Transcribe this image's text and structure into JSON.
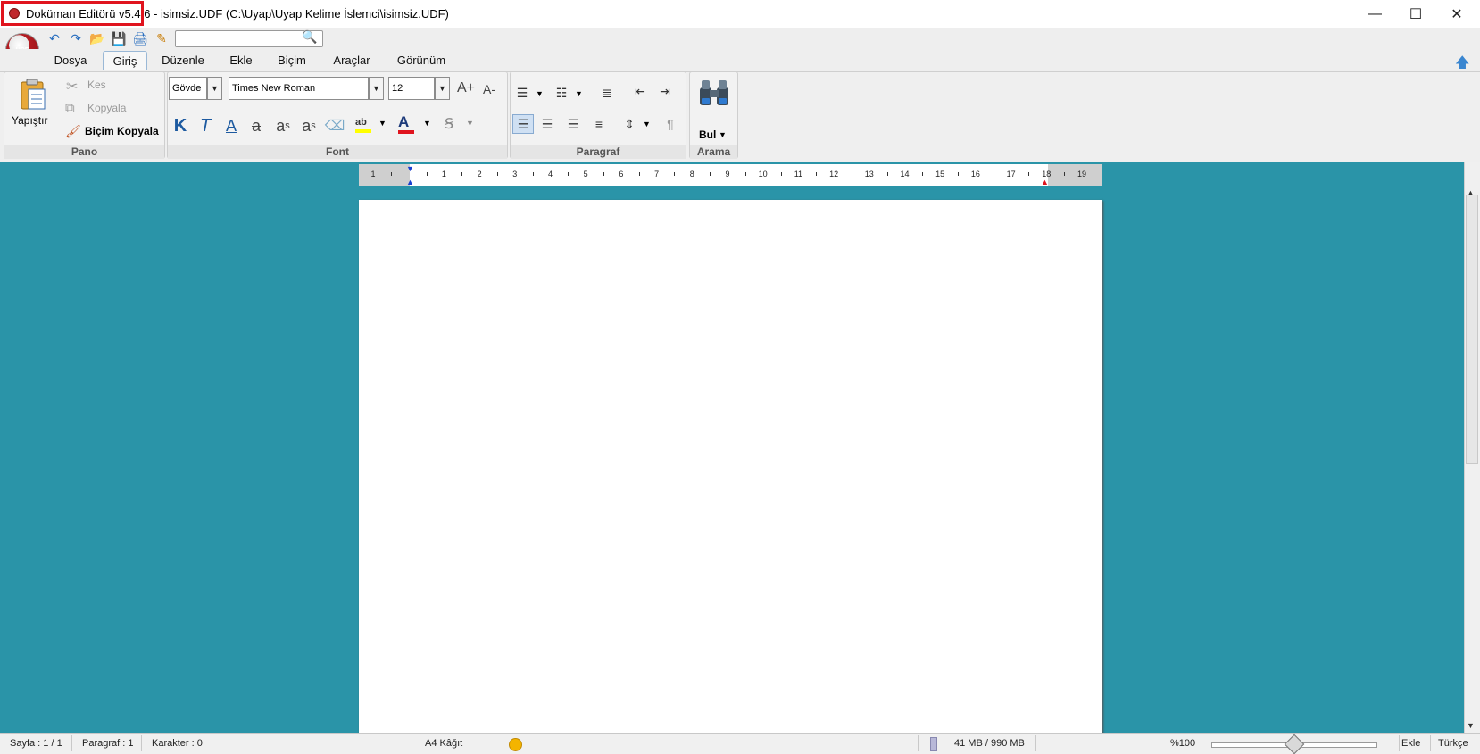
{
  "window": {
    "title_app": "Doküman Editörü v5.4.6",
    "title_file": " - isimsiz.UDF (C:\\Uyap\\Uyap Kelime İslemci\\isimsiz.UDF)",
    "minimize": "—",
    "maximize": "☐",
    "close": "✕"
  },
  "quick_toolbar": {
    "logo_text": "UDF",
    "undo_icon": "↶",
    "redo_icon": "↷",
    "open_icon": "📂",
    "save_icon": "💾",
    "print_icon": "🖨",
    "edit_icon": "✎",
    "search_value": "",
    "search_icon": "🔍"
  },
  "tabs": [
    "Dosya",
    "Giriş",
    "Düzenle",
    "Ekle",
    "Biçim",
    "Araçlar",
    "Görünüm"
  ],
  "ribbon": {
    "pano": {
      "label": "Pano",
      "paste": "Yapıştır",
      "cut": "Kes",
      "copy": "Kopyala",
      "format_painter": "Biçim Kopyala"
    },
    "font": {
      "label": "Font",
      "style_value": "Gövde",
      "font_value": "Times New Roman",
      "size_value": "12",
      "grow": "A+",
      "shrink": "A-",
      "bold": "K",
      "italic": "T",
      "underline": "A",
      "strike": "a",
      "subscript": "a",
      "subscript_mark": "s",
      "superscript": "a",
      "superscript_mark": "s",
      "highlight": "ab",
      "font_color": "A"
    },
    "paragraf": {
      "label": "Paragraf"
    },
    "arama": {
      "label": "Arama",
      "find": "Bul"
    }
  },
  "ruler": {
    "numbers": [
      "1",
      "",
      "1",
      "2",
      "3",
      "4",
      "5",
      "6",
      "7",
      "8",
      "9",
      "10",
      "11",
      "12",
      "13",
      "14",
      "15",
      "16",
      "17",
      "18",
      "19"
    ]
  },
  "status": {
    "page": "Sayfa : 1 / 1",
    "paragraph": "Paragraf : 1",
    "chars": "Karakter : 0",
    "paper": "A4 Kâğıt",
    "memory": "41 MB / 990 MB",
    "zoom": "%100",
    "mode": "Ekle",
    "language": "Türkçe"
  },
  "colors": {
    "workspace": "#2a94a8",
    "highlight_box": "#e0141e",
    "font_color_bar": "#e0141e",
    "highlight_bar": "#ffff00"
  }
}
